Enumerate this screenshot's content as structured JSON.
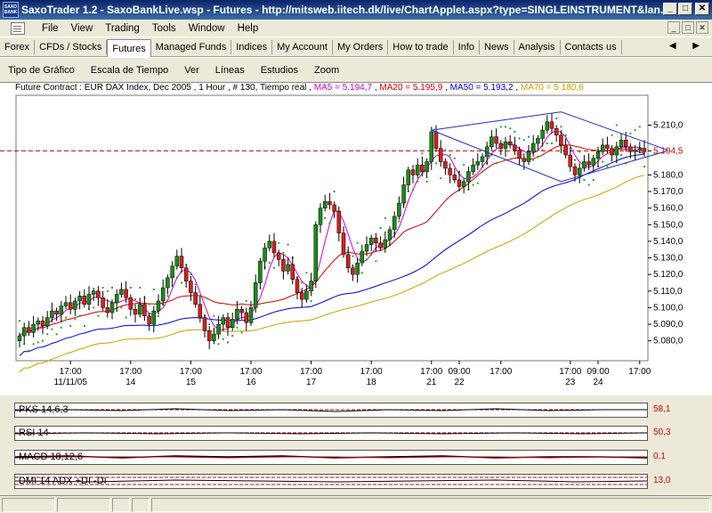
{
  "window": {
    "title": "SaxoTrader 1.2 - SaxoBankLive.wsp - Futures - http://mitsweb.iitech.dk/live/ChartApplet.aspx?type=SINGLEINSTRUMENT&lan...",
    "icon_text": "SAXO BANK",
    "minimize": "_",
    "maximize": "□",
    "close": "✕"
  },
  "menu": {
    "items": [
      "File",
      "View",
      "Trading",
      "Tools",
      "Window",
      "Help"
    ]
  },
  "tabs": [
    "Forex",
    "CFDs / Stocks",
    "Futures",
    "Managed Funds",
    "Indices",
    "My Account",
    "My Orders",
    "How to trade",
    "Info",
    "News",
    "Analysis",
    "Contacts us"
  ],
  "active_tab": "Futures",
  "tab_arrows": "◀ ▶",
  "chart_menu": [
    "Tipo de Gráfico",
    "Escala de Tiempo",
    "Ver",
    "Líneas",
    "Estudios",
    "Zoom"
  ],
  "legend": {
    "contract": "Future Contract : EUR DAX Index, Dec 2005 , 1 Hour , # 130, Tiempo real",
    "ma5": "MA5 = 5.194,7",
    "ma20": "MA20 = 5.195,9",
    "ma50": "MA50 = 5.193,2",
    "ma70": "MA70 = 5.180,6",
    "colors": {
      "ma5": "#cc00cc",
      "ma20": "#cc0000",
      "ma50": "#0000cc",
      "ma70": "#c8a000"
    }
  },
  "chart_data": {
    "type": "candlestick",
    "y_ticks": [
      "5.210,0",
      "5.194,5",
      "5.180,0",
      "5.170,0",
      "5.160,0",
      "5.150,0",
      "5.140,0",
      "5.130,0",
      "5.120,0",
      "5.110,0",
      "5.100,0",
      "5.090,0",
      "5.080,0"
    ],
    "y_tick_values": [
      5210,
      5194.5,
      5180,
      5170,
      5160,
      5150,
      5140,
      5130,
      5120,
      5110,
      5100,
      5090,
      5080
    ],
    "current_price": "5.194,5",
    "current_value": 5194.5,
    "ylim": [
      5068,
      5228
    ],
    "x_ticks": [
      {
        "time": "17:00",
        "date": "11/11/05",
        "i": 11
      },
      {
        "time": "17:00",
        "date": "14",
        "i": 24
      },
      {
        "time": "17:00",
        "date": "15",
        "i": 37
      },
      {
        "time": "17:00",
        "date": "16",
        "i": 50
      },
      {
        "time": "17:00",
        "date": "17",
        "i": 63
      },
      {
        "time": "17:00",
        "date": "18",
        "i": 76
      },
      {
        "time": "17:00",
        "date": "21",
        "i": 89
      },
      {
        "time": "09:00",
        "date": "22",
        "i": 95
      },
      {
        "time": "17:00",
        "date": "",
        "i": 104
      },
      {
        "time": "17:00",
        "date": "23",
        "i": 119
      },
      {
        "time": "09:00",
        "date": "24",
        "i": 125
      },
      {
        "time": "17:00",
        "date": "",
        "i": 134
      }
    ],
    "closes": [
      5083,
      5088,
      5085,
      5090,
      5092,
      5089,
      5094,
      5098,
      5096,
      5101,
      5103,
      5099,
      5104,
      5107,
      5102,
      5108,
      5110,
      5106,
      5100,
      5097,
      5103,
      5108,
      5111,
      5106,
      5099,
      5096,
      5102,
      5095,
      5090,
      5098,
      5104,
      5112,
      5118,
      5125,
      5131,
      5124,
      5116,
      5109,
      5102,
      5094,
      5086,
      5080,
      5084,
      5090,
      5094,
      5088,
      5093,
      5099,
      5097,
      5091,
      5100,
      5115,
      5128,
      5136,
      5140,
      5133,
      5129,
      5122,
      5126,
      5117,
      5109,
      5105,
      5110,
      5116,
      5150,
      5160,
      5164,
      5162,
      5158,
      5145,
      5132,
      5124,
      5120,
      5127,
      5134,
      5138,
      5142,
      5139,
      5136,
      5141,
      5147,
      5155,
      5163,
      5174,
      5183,
      5180,
      5186,
      5182,
      5188,
      5206,
      5196,
      5188,
      5184,
      5180,
      5177,
      5173,
      5176,
      5182,
      5186,
      5188,
      5191,
      5197,
      5203,
      5199,
      5196,
      5200,
      5198,
      5195,
      5190,
      5188,
      5194,
      5199,
      5202,
      5207,
      5212,
      5208,
      5204,
      5198,
      5192,
      5185,
      5180,
      5184,
      5188,
      5186,
      5190,
      5194,
      5198,
      5196,
      5192,
      5197,
      5201,
      5197,
      5194,
      5195,
      5196,
      5194
    ],
    "trendlines": {
      "upper_channel": [
        [
          89,
          5207
        ],
        [
          117,
          5218
        ],
        [
          140,
          5195
        ]
      ],
      "lower_channel": [
        [
          89,
          5207
        ],
        [
          117,
          5176
        ],
        [
          140,
          5194.5
        ]
      ]
    }
  },
  "indicators": [
    {
      "label": "PKS 14,6,3",
      "value": "58,1"
    },
    {
      "label": "RSI 14",
      "value": "50,3"
    },
    {
      "label": "MACD 18,12,6",
      "value": "0,1"
    },
    {
      "label": "DMI 14 ADX +DI -DI",
      "value": "13,0",
      "plus_di": "+DI",
      "minus_di": "-DI"
    }
  ]
}
